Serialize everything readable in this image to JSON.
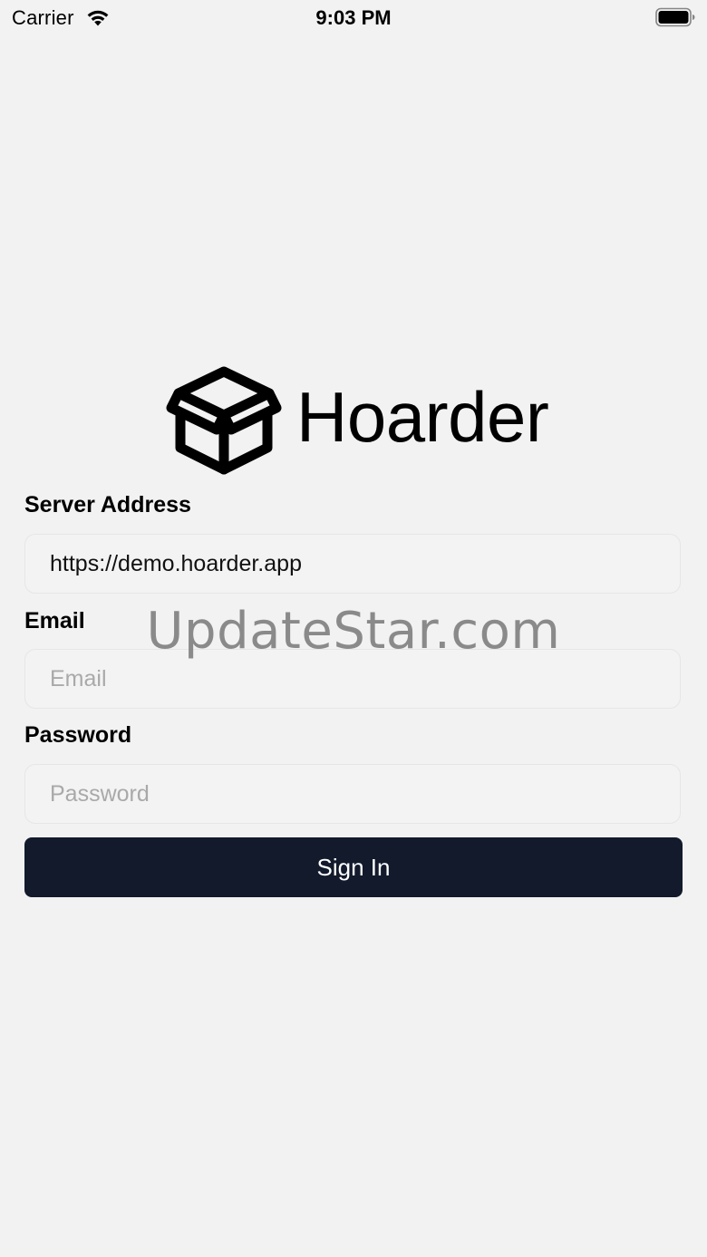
{
  "status_bar": {
    "carrier": "Carrier",
    "time": "9:03 PM",
    "wifi_icon": "wifi-icon",
    "battery_icon": "battery-full-icon"
  },
  "app": {
    "name": "Hoarder",
    "logo_icon": "package-box-icon"
  },
  "form": {
    "server": {
      "label": "Server Address",
      "value": "https://demo.hoarder.app",
      "placeholder": ""
    },
    "email": {
      "label": "Email",
      "value": "",
      "placeholder": "Email"
    },
    "password": {
      "label": "Password",
      "value": "",
      "placeholder": "Password"
    },
    "submit_label": "Sign In"
  },
  "watermark": "UpdateStar.com",
  "colors": {
    "background": "#f2f2f2",
    "button": "#121a2c",
    "button_text": "#ffffff",
    "placeholder": "#a9a9a9"
  }
}
